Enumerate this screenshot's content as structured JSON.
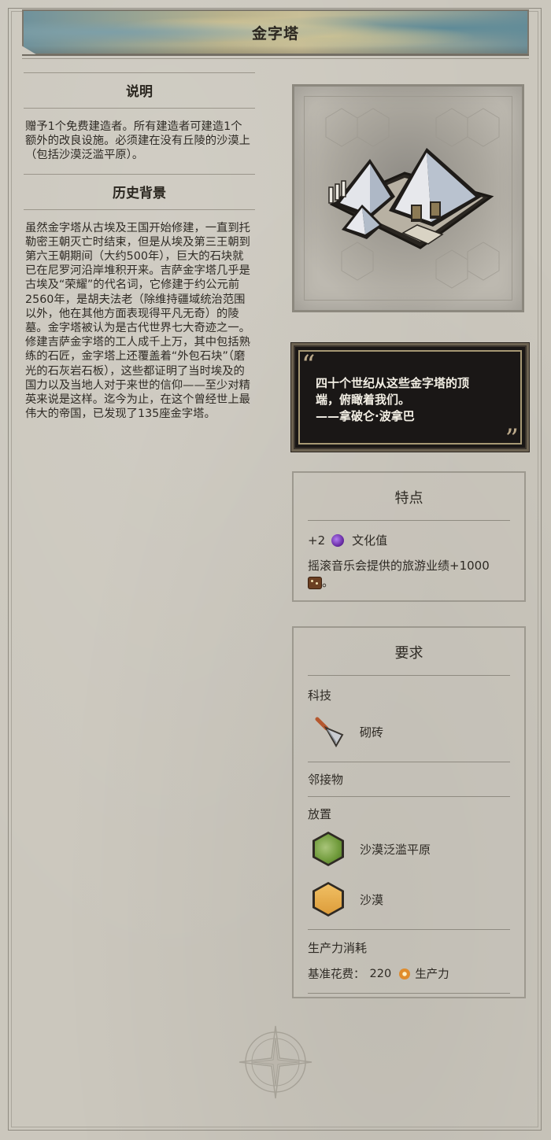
{
  "header": {
    "title": "金字塔"
  },
  "left": {
    "description_heading": "说明",
    "description": "赠予1个免费建造者。所有建造者可建造1个额外的改良设施。必须建在没有丘陵的沙漠上（包括沙漠泛滥平原）。",
    "history_heading": "历史背景",
    "history": "虽然金字塔从古埃及王国开始修建，一直到托勒密王朝灭亡时结束，但是从埃及第三王朝到第六王朝期间（大约500年），巨大的石块就已在尼罗河沿岸堆积开来。吉萨金字塔几乎是古埃及“荣耀”的代名词，它修建于约公元前2560年，是胡夫法老（除维持疆域统治范围以外，他在其他方面表现得平凡无奇）的陵墓。金字塔被认为是古代世界七大奇迹之一。修建吉萨金字塔的工人成千上万，其中包括熟练的石匠，金字塔上还覆盖着“外包石块”（磨光的石灰岩石板），这些都证明了当时埃及的国力以及当地人对于来世的信仰——至少对精英来说是这样。迄今为止，在这个曾经世上最伟大的帝国，已发现了135座金字塔。"
  },
  "quote": {
    "line1": "四十个世纪从这些金字塔的顶",
    "line2": "端，俯瞰着我们。",
    "author": "——拿破仑·波拿巴"
  },
  "traits": {
    "title": "特点",
    "culture_amount": "+2",
    "culture_label": "文化值",
    "tourism_text": "摇滚音乐会提供的旅游业绩+1000",
    "tourism_suffix": "。"
  },
  "requirements": {
    "title": "要求",
    "tech_heading": "科技",
    "tech_name": "砌砖",
    "adjacent_heading": "邻接物",
    "placement_heading": "放置",
    "placement": [
      "沙漠泛滥平原",
      "沙漠"
    ],
    "cost_heading": "生产力消耗",
    "cost_label": "基准花费：",
    "cost_value": "220",
    "cost_unit": "生产力"
  },
  "colors": {
    "quote_bg": "#1a1716",
    "culture": "#6b2fa8",
    "floodplain": "#6f9a3a",
    "desert": "#e2a94a"
  }
}
